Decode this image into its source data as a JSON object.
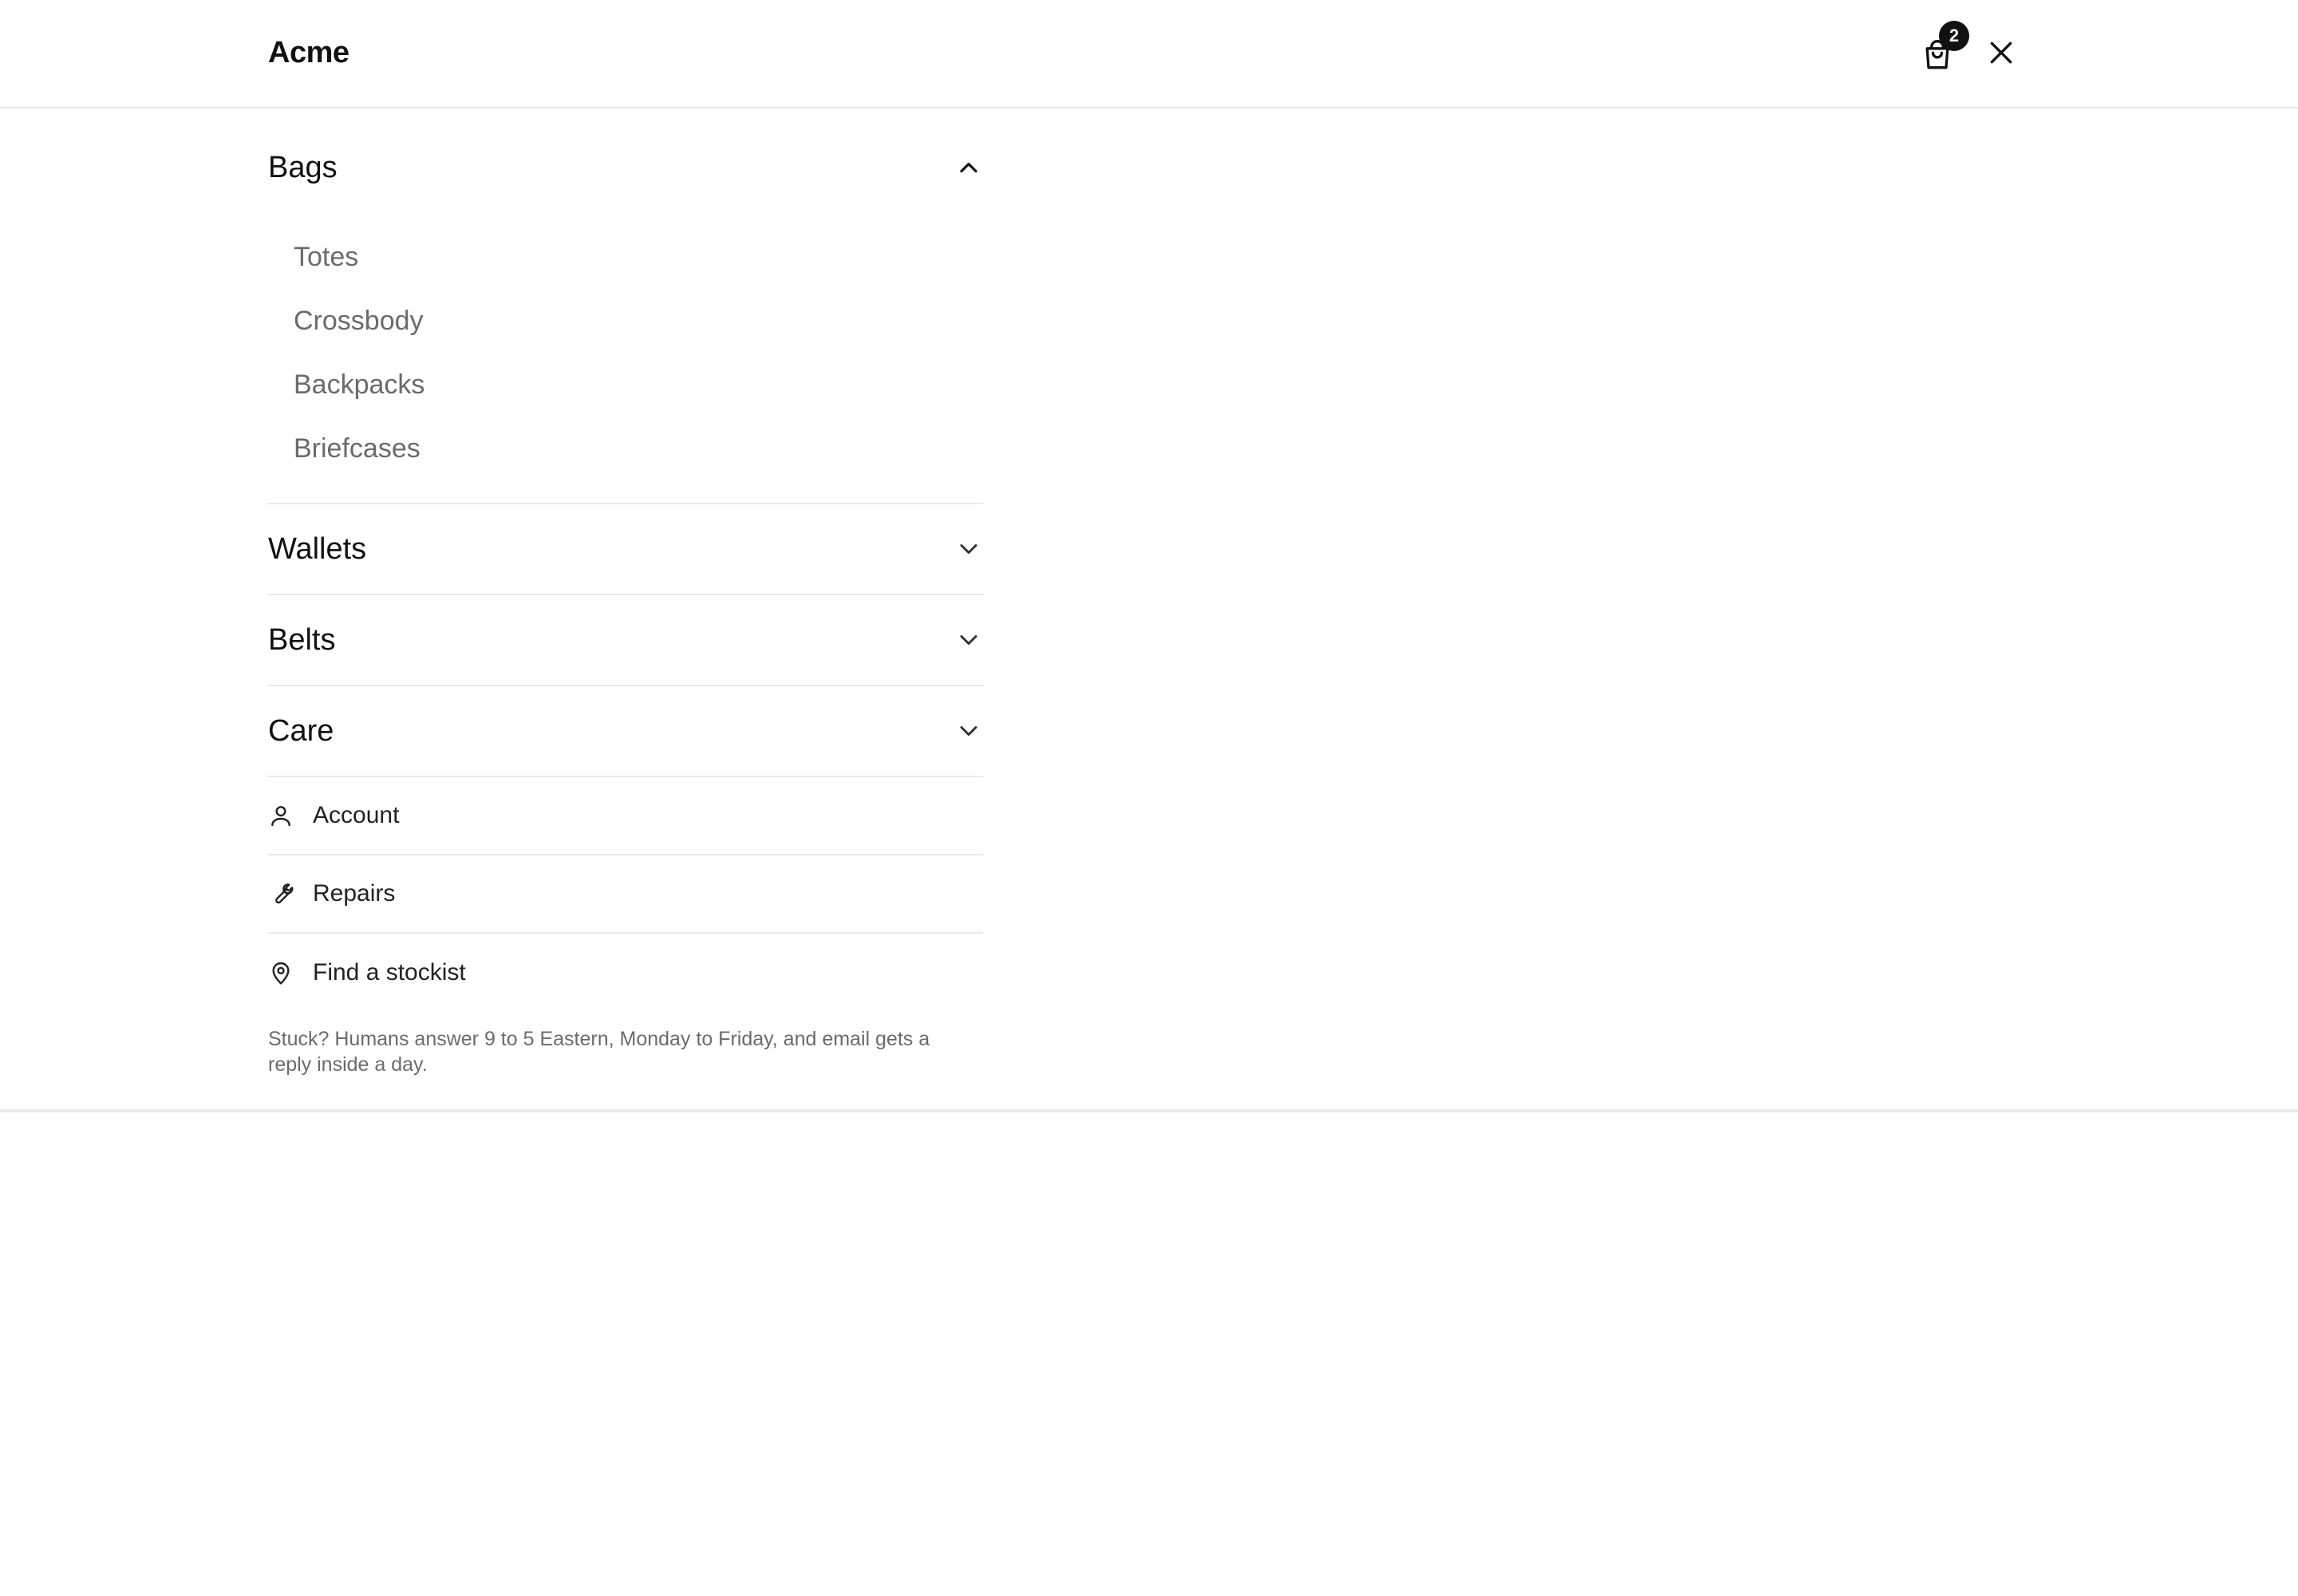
{
  "header": {
    "brand": "Acme",
    "cart_count": "2"
  },
  "menu": {
    "sections": [
      {
        "title": "Bags",
        "expanded": true,
        "items": [
          "Totes",
          "Crossbody",
          "Backpacks",
          "Briefcases"
        ]
      },
      {
        "title": "Wallets",
        "expanded": false
      },
      {
        "title": "Belts",
        "expanded": false
      },
      {
        "title": "Care",
        "expanded": false
      }
    ],
    "utility": [
      {
        "label": "Account",
        "icon": "user-icon"
      },
      {
        "label": "Repairs",
        "icon": "wrench-icon"
      },
      {
        "label": "Find a stockist",
        "icon": "map-pin-icon"
      }
    ],
    "help_note": "Stuck? Humans answer 9 to 5 Eastern, Monday to Friday, and email gets a reply inside a day."
  },
  "colors": {
    "text_primary": "#111111",
    "text_secondary": "#6b6b6b",
    "divider": "#e9e9e9",
    "badge_bg": "#111111",
    "background": "#ffffff"
  }
}
